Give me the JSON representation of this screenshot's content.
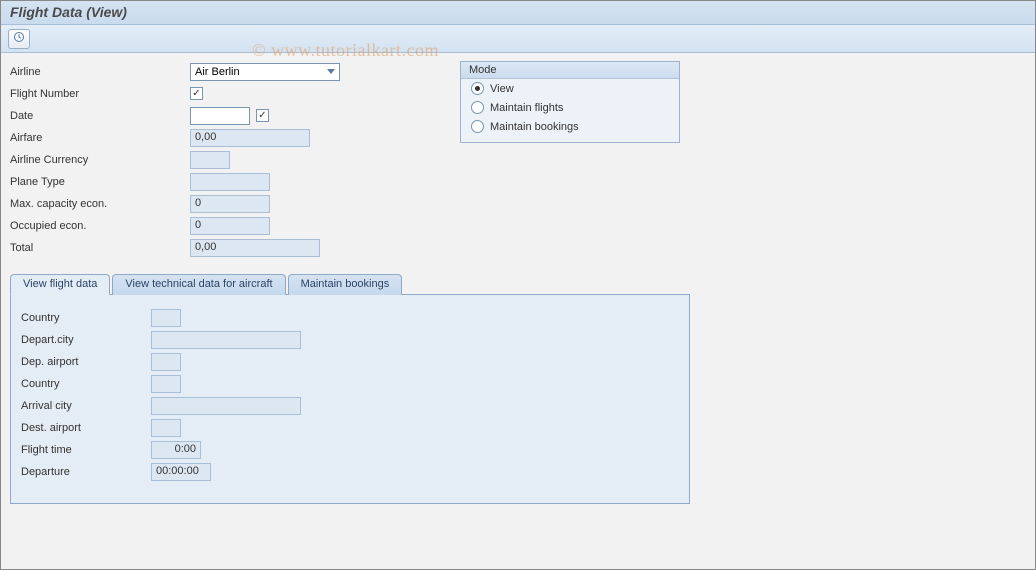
{
  "title": "Flight Data (View)",
  "watermark": "© www.tutorialkart.com",
  "form": {
    "airline_label": "Airline",
    "airline_value": "Air Berlin",
    "flight_number_label": "Flight Number",
    "date_label": "Date",
    "airfare_label": "Airfare",
    "airfare_value": "0,00",
    "airline_currency_label": "Airline Currency",
    "plane_type_label": "Plane Type",
    "max_capacity_label": "Max. capacity econ.",
    "max_capacity_value": "0",
    "occupied_label": "Occupied econ.",
    "occupied_value": "0",
    "total_label": "Total",
    "total_value": "0,00"
  },
  "mode": {
    "title": "Mode",
    "options": {
      "view": "View",
      "maintain_flights": "Maintain flights",
      "maintain_bookings": "Maintain bookings"
    },
    "selected": "view"
  },
  "tabs": {
    "view_flight_data": "View flight data",
    "view_tech_data": "View technical data for aircraft",
    "maintain_bookings": "Maintain bookings"
  },
  "details": {
    "country1_label": "Country",
    "depart_city_label": "Depart.city",
    "dep_airport_label": "Dep. airport",
    "country2_label": "Country",
    "arrival_city_label": "Arrival city",
    "dest_airport_label": "Dest. airport",
    "flight_time_label": "Flight time",
    "flight_time_value": "0:00",
    "departure_label": "Departure",
    "departure_value": "00:00:00"
  }
}
